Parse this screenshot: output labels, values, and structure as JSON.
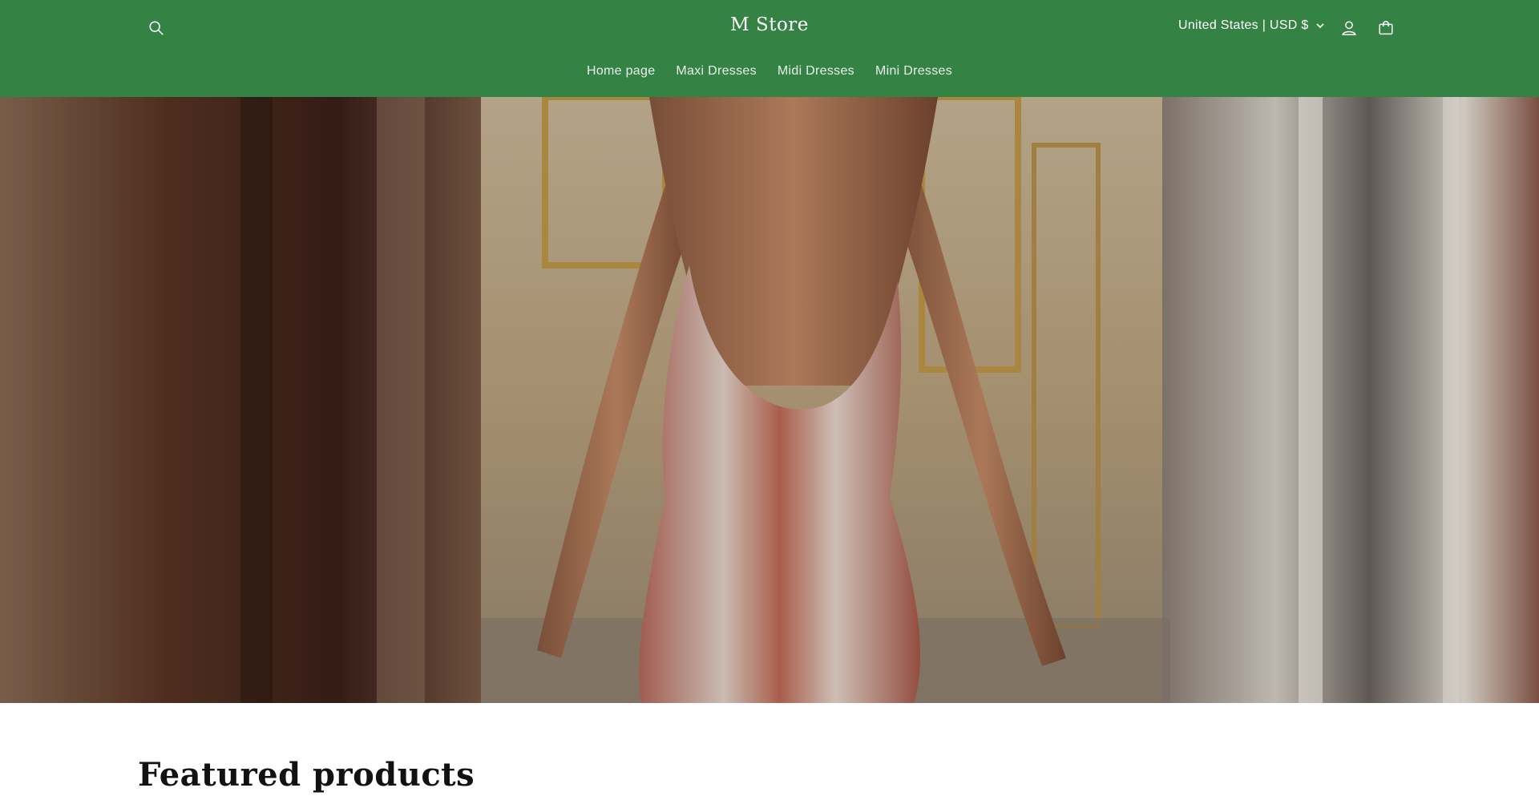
{
  "header": {
    "store_name": "M Store",
    "locale_label": "United States | USD $",
    "background_color": "#358245",
    "icons": {
      "search": "search-icon",
      "account": "account-icon",
      "cart": "cart-icon",
      "locale_chevron": "chevron-down-icon"
    }
  },
  "nav": {
    "items": [
      {
        "label": "Home page"
      },
      {
        "label": "Maxi Dresses"
      },
      {
        "label": "Midi Dresses"
      },
      {
        "label": "Mini Dresses"
      }
    ]
  },
  "hero": {
    "image": "hero-banner-image"
  },
  "featured": {
    "heading": "Featured products"
  }
}
